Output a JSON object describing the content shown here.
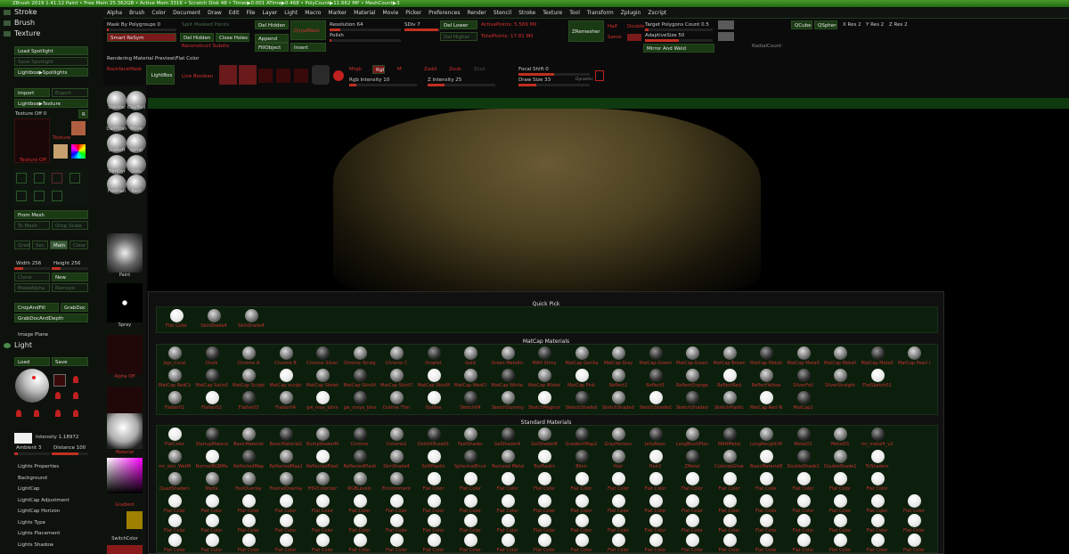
{
  "titlebar": "ZBrush 2019   1.41.12 Paint   • Free Mem 25.362GB • Active Mem 3316 • Scratch Disk 48 • Timer▶0.001 ATime▶0.468 • PolyCount▶11.662 MP • MeshCount▶3",
  "menu": [
    "Alpha",
    "Brush",
    "Color",
    "Document",
    "Draw",
    "Edit",
    "File",
    "Layer",
    "Light",
    "Macro",
    "Marker",
    "Material",
    "Movie",
    "Picker",
    "Preferences",
    "Render",
    "Stencil",
    "Stroke",
    "Texture",
    "Tool",
    "Transform",
    "Zplugin",
    "Zscript"
  ],
  "left": {
    "stroke": "Stroke",
    "brush": "Brush",
    "texture": "Texture",
    "load_spotlight": "Load Spotlight",
    "save_spotlight": "Save Spotlight",
    "lightbox_spotlights": "Lightbox▶Spotlights",
    "import": "Import",
    "export": "Export",
    "lightbox_texture": "Lightbox▶Texture",
    "texture_off": "Texture Off  0",
    "r": "R",
    "texture_lbl": "Texture",
    "texture_off2": "Texture Off",
    "from_mesh": "From Mesh",
    "to_mesh": "To Mesh",
    "drop_scale": "Drop Scale",
    "grad": "Grad",
    "sec": "Sec",
    "main": "Main",
    "clear": "Clear",
    "width": "Width 256",
    "height": "Height 256",
    "clone": "Clone",
    "new": "New",
    "make_alpha": "MakeAlpha",
    "remove": "Remove",
    "crop_fill": "CropAndFill",
    "grab_doc": "GrabDoc",
    "grab_doc_depth": "GrabDocAndDepth",
    "image_plane": "Image Plane",
    "light": "Light",
    "load": "Load",
    "save": "Save",
    "intensity": "Intensity 1.18972",
    "ambient": "Ambient 3",
    "distance": "Distance 100",
    "items": [
      "Lights Properties",
      "Background",
      "LightCap",
      "LightCap Adjustment",
      "LightCap Horizon",
      "Lights Type",
      "Lights Placement",
      "Lights Shadow"
    ]
  },
  "shelf": {
    "labels": [
      "Standar",
      "ClayBuil",
      "DamStan",
      "Move",
      "SnakeH",
      "Spiral",
      "TrimDyr",
      "Dots",
      "Freehan",
      "Rect",
      "Paint",
      "Spray",
      "Alpha Off",
      "Texture Off",
      "Material",
      "Gradient",
      "SwitchColor"
    ]
  },
  "top": {
    "mask_by_polygroups": "Mask By Polygroups 0",
    "smart_resym": "Smart ReSym",
    "split_masked": "Split Masked Points",
    "del_hidden": "Del Hidden",
    "close_holes": "Close Holes",
    "append": "Append",
    "fill_object": "FillObject",
    "insert": "Insert",
    "reconstruct": "Reconstruct Subdiv",
    "del_hidden2": "Del Hidden",
    "dynamesh": "DynaMesh",
    "resolution": "Resolution 64",
    "polish": "Polish",
    "sdiv": "SDiv 7",
    "del_lower": "Del Lower",
    "del_higher": "Del Higher",
    "active_points": "ActivePoints: 5.569 Mil",
    "total_points": "TotalPoints: 17.81 Mil",
    "zremesher": "ZRemesher",
    "half": "Half",
    "same": "Same",
    "double": "Double",
    "target_polys": "Target Polygons Count 0.5",
    "adaptive_size": "AdaptiveSize 50",
    "mirror_weld": "Mirror And Weld",
    "radial_count": "RadialCount",
    "qcube": "QCube",
    "qsphere": "QSphere",
    "xres": "X Res 2",
    "yres": "Y Res 2",
    "zres": "Z Res 2",
    "rendering": "Rendering Material Preview\\Flat Color",
    "backface": "BackfaceMask",
    "lightbox": "LightBox",
    "live_boolean": "Live Boolean",
    "mrgb": "Mrgb",
    "rgb": "Rgb",
    "m": "M",
    "zadd": "Zadd",
    "zsub": "Zsub",
    "zcut": "Zcut",
    "rgb_intensity": "Rgb Intensity 10",
    "z_intensity": "Z Intensity 25",
    "focal_shift": "Focal Shift 0",
    "draw_size": "Draw Size 33",
    "dynamic": "Dynamic"
  },
  "popup": {
    "quick_pick": "Quick Pick",
    "quick": [
      "Flat Color",
      "SkinShade4",
      "SkinShade4"
    ],
    "matcap_title": "MatCap Materials",
    "matcap_row1": [
      "bgs_Coral",
      "Chalk",
      "Chrome A",
      "Chrome B",
      "Chrome SilverTint",
      "Chrome Straight",
      "Chrome C",
      "Droplet",
      "Gold",
      "Green Metallic",
      "MAH Shiny",
      "MatCap Gorilla",
      "MatCap Gray",
      "MatCap GreenClay",
      "MatCap GreenFlat",
      "MatCap Brown",
      "MatCap Metal01",
      "MatCap Metal02",
      "MatCap Metal03",
      "MatCap Metal04",
      "MatCap Pearl Ca"
    ],
    "matcap_row2": [
      "MatCap RedClay",
      "MatCap Satin01",
      "MatCap Sculpt",
      "MatCap sculpty2",
      "MatCap Skeleton",
      "MatCap Skin04",
      "MatCap Skin05",
      "MatCap Skin06",
      "MatCap WedClay",
      "MatCap White Cl",
      "MatCap WhiteFlat",
      "MatCap Pink",
      "Reflect2",
      "Reflect3",
      "ReflectOrange",
      "ReflectRed",
      "ReflectYellow",
      "SilverFoil",
      "SilverStraight",
      "FlatSketch01"
    ],
    "matcap_row3": [
      "Flatter01",
      "Flatter02",
      "Flatter03",
      "Flatter04",
      "gw_max_blinn",
      "gw_maya_blinn",
      "Outline Thin",
      "Outline",
      "Sketch04",
      "SketchDummy",
      "SketchMagnumSt",
      "SketchShaded",
      "SketchShaded2",
      "SketchShaded3",
      "SketchShaded4",
      "SketchPlastic",
      "MatCap Red Wax",
      "MatCap2"
    ],
    "standard_title": "Standard Materials",
    "std_row1": [
      "FlatColor",
      "StartupMaterial",
      "BasicMaterial",
      "BasicMaterial2",
      "BumpViewerMat",
      "Chrome",
      "Chrome2",
      "DotsDiffuse01",
      "FastShader",
      "GelShaderA",
      "GelShaderB",
      "GradientMap2",
      "GrayHorizon",
      "JellyBean",
      "LongBlushPlastic",
      "MAHMetal",
      "LongRoughDiffuse",
      "Metal01",
      "Metal03",
      "mr_metal4_v2"
    ],
    "std_row2": [
      "mr_skin_WetMat",
      "NormalRGBMat",
      "ReflectedMap",
      "ReflectedMap2",
      "ReflectedPlastic",
      "ReflectedPlasticB",
      "SkinShade4",
      "SoftPlastic",
      "SphericalEnviron",
      "Textured Metal",
      "ToyPlastic",
      "Blinn",
      "Hair",
      "Hair2",
      "ZMetal",
      "ColorizeGlow",
      "BasicMaterialB",
      "DoubleShade1",
      "DoubleShade1",
      "TriShaders"
    ],
    "std_row3": [
      "QuadShaders",
      "Matte",
      "FastOverlay",
      "FresnelOverlay",
      "HSVColorizer",
      "RGBLevels",
      "Environment",
      "Flat Color",
      "Flat Color",
      "Flat Color",
      "Flat Color",
      "Flat Color",
      "Flat Color",
      "Flat Color",
      "Flat Color",
      "Flat Color",
      "Flat Color",
      "Flat Color",
      "Flat Color",
      "Flat Color"
    ],
    "flat": "Flat Color"
  }
}
